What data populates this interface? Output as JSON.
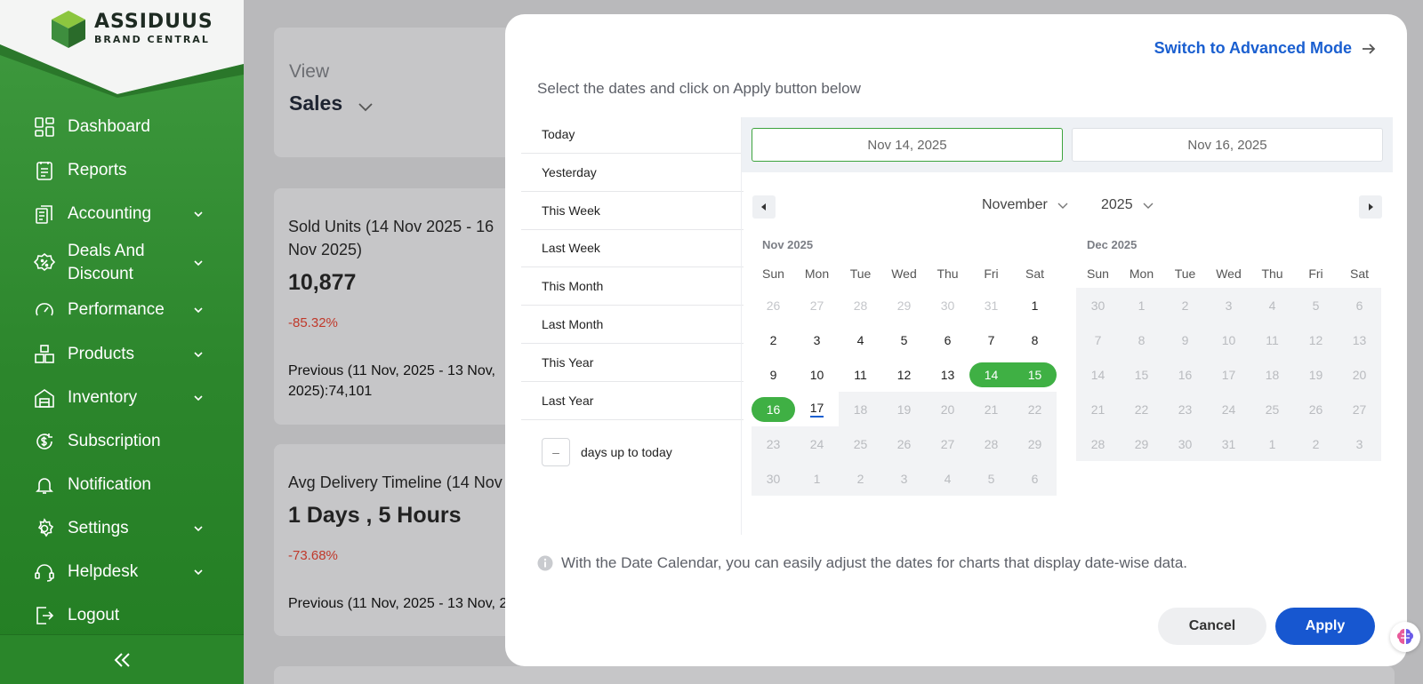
{
  "brand": {
    "name": "ASSIDUUS",
    "tagline": "BRAND CENTRAL"
  },
  "sidebar": {
    "items": [
      {
        "label": "Dashboard",
        "icon": "dashboard-icon",
        "expandable": false
      },
      {
        "label": "Reports",
        "icon": "reports-icon",
        "expandable": false
      },
      {
        "label": "Accounting",
        "icon": "accounting-icon",
        "expandable": true
      },
      {
        "label": "Deals And Discount",
        "icon": "discount-icon",
        "expandable": true
      },
      {
        "label": "Performance",
        "icon": "performance-icon",
        "expandable": true
      },
      {
        "label": "Products",
        "icon": "products-icon",
        "expandable": true
      },
      {
        "label": "Inventory",
        "icon": "inventory-icon",
        "expandable": true
      },
      {
        "label": "Subscription",
        "icon": "subscription-icon",
        "expandable": false
      },
      {
        "label": "Notification",
        "icon": "bell-icon",
        "expandable": false
      },
      {
        "label": "Settings",
        "icon": "gear-icon",
        "expandable": true
      },
      {
        "label": "Helpdesk",
        "icon": "headset-icon",
        "expandable": true
      },
      {
        "label": "Logout",
        "icon": "logout-icon",
        "expandable": false
      }
    ],
    "collapse_icon": "double-chevron-left-icon"
  },
  "main": {
    "view": {
      "label": "View",
      "value": "Sales"
    },
    "sold_units": {
      "title": "Sold Units (14 Nov 2025 - 16 Nov 2025)",
      "value": "10,877",
      "change": "-85.32%",
      "previous": "Previous (11 Nov, 2025 - 13 Nov, 2025):74,101"
    },
    "avg_delivery": {
      "title": "Avg Delivery Timeline (14 Nov",
      "value": "1 Days , 5 Hours",
      "change": "-73.68%",
      "previous": "Previous (11 Nov, 2025 - 13 Nov, 2"
    }
  },
  "modal": {
    "advanced_link": "Switch to Advanced Mode",
    "instruction": "Select the dates and click on Apply button below",
    "presets": [
      "Today",
      "Yesterday",
      "This Week",
      "Last Week",
      "This Month",
      "Last Month",
      "This Year",
      "Last Year"
    ],
    "days_input": {
      "value": "–",
      "suffix": "days up to today"
    },
    "start_date": "Nov 14, 2025",
    "end_date": "Nov 16, 2025",
    "month_select": "November",
    "year_select": "2025",
    "weekdays": [
      "Sun",
      "Mon",
      "Tue",
      "Wed",
      "Thu",
      "Fri",
      "Sat"
    ],
    "calendars": [
      {
        "title": "Nov 2025",
        "weeks": [
          [
            [
              "26",
              "other"
            ],
            [
              "27",
              "other"
            ],
            [
              "28",
              "other"
            ],
            [
              "29",
              "other"
            ],
            [
              "30",
              "other"
            ],
            [
              "31",
              "other"
            ],
            [
              "1",
              "cur"
            ]
          ],
          [
            [
              "2",
              "cur"
            ],
            [
              "3",
              "cur"
            ],
            [
              "4",
              "cur"
            ],
            [
              "5",
              "cur"
            ],
            [
              "6",
              "cur"
            ],
            [
              "7",
              "cur"
            ],
            [
              "8",
              "cur"
            ]
          ],
          [
            [
              "9",
              "cur"
            ],
            [
              "10",
              "cur"
            ],
            [
              "11",
              "cur"
            ],
            [
              "12",
              "cur"
            ],
            [
              "13",
              "cur"
            ],
            [
              "14",
              "sel"
            ],
            [
              "15",
              "sel"
            ]
          ],
          [
            [
              "16",
              "sel"
            ],
            [
              "17",
              "today"
            ],
            [
              "18",
              "dis"
            ],
            [
              "19",
              "dis"
            ],
            [
              "20",
              "dis"
            ],
            [
              "21",
              "dis"
            ],
            [
              "22",
              "dis"
            ]
          ],
          [
            [
              "23",
              "dis"
            ],
            [
              "24",
              "dis"
            ],
            [
              "25",
              "dis"
            ],
            [
              "26",
              "dis"
            ],
            [
              "27",
              "dis"
            ],
            [
              "28",
              "dis"
            ],
            [
              "29",
              "dis"
            ]
          ],
          [
            [
              "30",
              "dis"
            ],
            [
              "1",
              "dis"
            ],
            [
              "2",
              "dis"
            ],
            [
              "3",
              "dis"
            ],
            [
              "4",
              "dis"
            ],
            [
              "5",
              "dis"
            ],
            [
              "6",
              "dis"
            ]
          ]
        ]
      },
      {
        "title": "Dec 2025",
        "weeks": [
          [
            [
              "30",
              "dis"
            ],
            [
              "1",
              "dis"
            ],
            [
              "2",
              "dis"
            ],
            [
              "3",
              "dis"
            ],
            [
              "4",
              "dis"
            ],
            [
              "5",
              "dis"
            ],
            [
              "6",
              "dis"
            ]
          ],
          [
            [
              "7",
              "dis"
            ],
            [
              "8",
              "dis"
            ],
            [
              "9",
              "dis"
            ],
            [
              "10",
              "dis"
            ],
            [
              "11",
              "dis"
            ],
            [
              "12",
              "dis"
            ],
            [
              "13",
              "dis"
            ]
          ],
          [
            [
              "14",
              "dis"
            ],
            [
              "15",
              "dis"
            ],
            [
              "16",
              "dis"
            ],
            [
              "17",
              "dis"
            ],
            [
              "18",
              "dis"
            ],
            [
              "19",
              "dis"
            ],
            [
              "20",
              "dis"
            ]
          ],
          [
            [
              "21",
              "dis"
            ],
            [
              "22",
              "dis"
            ],
            [
              "23",
              "dis"
            ],
            [
              "24",
              "dis"
            ],
            [
              "25",
              "dis"
            ],
            [
              "26",
              "dis"
            ],
            [
              "27",
              "dis"
            ]
          ],
          [
            [
              "28",
              "dis"
            ],
            [
              "29",
              "dis"
            ],
            [
              "30",
              "dis"
            ],
            [
              "31",
              "dis"
            ],
            [
              "1",
              "dis"
            ],
            [
              "2",
              "dis"
            ],
            [
              "3",
              "dis"
            ]
          ]
        ]
      }
    ],
    "info_text": "With the Date Calendar, you can easily adjust the dates for charts that display date-wise data.",
    "cancel_label": "Cancel",
    "apply_label": "Apply"
  },
  "colors": {
    "sidebar_green": "#2f8a2f",
    "selected_green": "#3fb044",
    "primary_blue": "#1757d0",
    "negative_red": "#c0392b"
  }
}
